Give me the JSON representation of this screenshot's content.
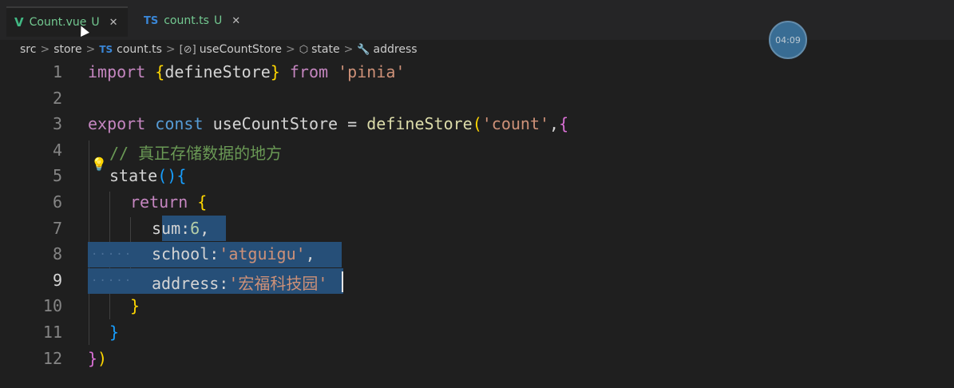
{
  "tabs": [
    {
      "icon": "V",
      "label": "Count.vue",
      "status": "U",
      "close": "✕"
    },
    {
      "icon": "TS",
      "label": "count.ts",
      "status": "U",
      "close": "✕"
    }
  ],
  "breadcrumb": {
    "parts": [
      "src",
      "store",
      "count.ts",
      "useCountStore",
      "state",
      "address"
    ],
    "file_badge": "TS",
    "separator": ">"
  },
  "overlay": {
    "timer": "04:09"
  },
  "editor": {
    "line_numbers": [
      "1",
      "2",
      "3",
      "4",
      "5",
      "6",
      "7",
      "8",
      "9",
      "10",
      "11",
      "12"
    ],
    "current_line": "9",
    "lines": {
      "l1": {
        "kw": "import",
        "ob": "{",
        "name": "defineStore",
        "cb": "}",
        "from": "from",
        "str": "'pinia'"
      },
      "l3": {
        "export": "export",
        "const": "const",
        "name": "useCountStore",
        "eq": "=",
        "fn": "defineStore",
        "op": "(",
        "str": "'count'",
        "comma": ",",
        "ob": "{"
      },
      "l4": {
        "comment": "// 真正存储数据的地方"
      },
      "l5": {
        "name": "state",
        "parens": "()",
        "ob": "{"
      },
      "l6": {
        "kw": "return",
        "ob": "{"
      },
      "l7": {
        "key": "sum",
        "colon": ":",
        "num": "6",
        "comma": ","
      },
      "l8": {
        "key": "school",
        "colon": ":",
        "str": "'atguigu'",
        "comma": ","
      },
      "l9": {
        "key": "address",
        "colon": ":",
        "str": "'宏福科技园'"
      },
      "l10": {
        "cb": "}"
      },
      "l11": {
        "cb": "}"
      },
      "l12": {
        "cb": "}",
        "cp": ")"
      }
    }
  },
  "colors": {
    "keyword": "#569cd6",
    "control": "#c586c0",
    "function": "#dcdcaa",
    "string": "#ce9178",
    "comment": "#6a9955",
    "selection": "#264f78"
  }
}
